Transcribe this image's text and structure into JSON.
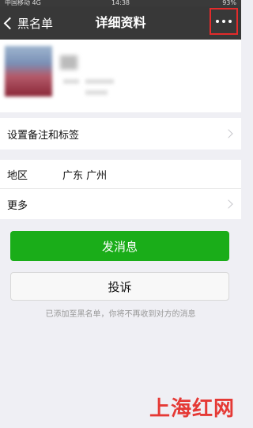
{
  "status_bar": {
    "carrier": "中国移动",
    "network": "4G",
    "time": "14:38",
    "battery": "93%"
  },
  "nav": {
    "back_label": "黑名单",
    "title": "详细资料",
    "more_icon": "more-dots-icon",
    "highlight_color": "#e32b2b"
  },
  "rows": {
    "tags_label": "设置备注和标签",
    "region_label": "地区",
    "region_value": "广东 广州",
    "more_label": "更多"
  },
  "actions": {
    "send_label": "发消息",
    "report_label": "投诉"
  },
  "notice": "已添加至黑名单，你将不再收到对方的消息",
  "watermark": "上海红网",
  "colors": {
    "primary_button": "#1aad19",
    "nav_bg": "#383838"
  }
}
